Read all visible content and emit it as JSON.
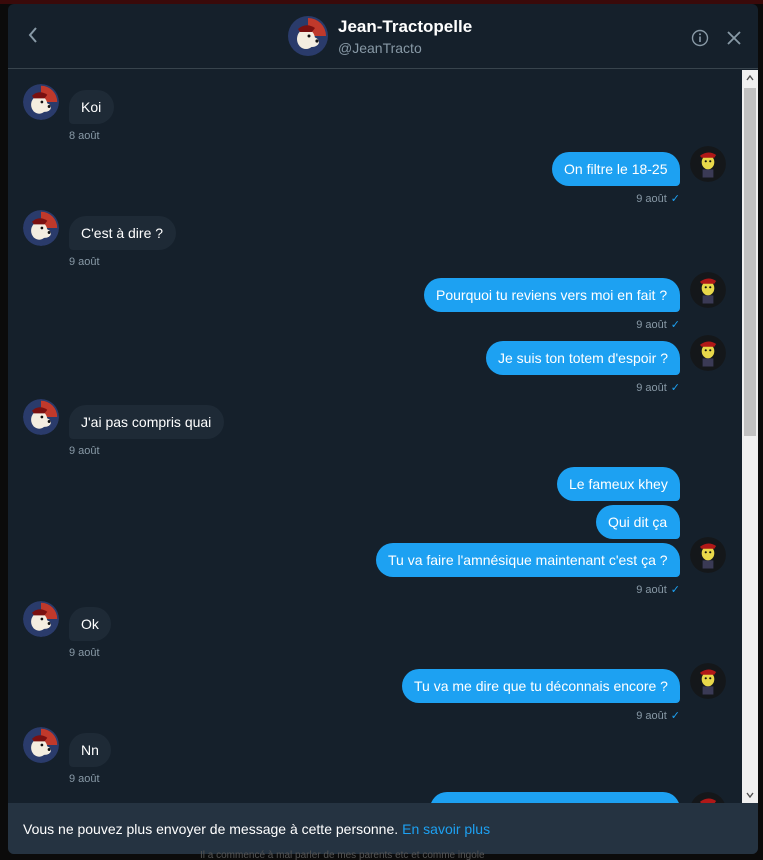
{
  "header": {
    "name": "Jean-Tractopelle",
    "handle": "@JeanTracto",
    "back_icon": "chevron-left-icon",
    "info_icon": "info-icon",
    "close_icon": "close-icon"
  },
  "messages": [
    {
      "dir": "in",
      "text": "Koi",
      "time": "8 août"
    },
    {
      "dir": "out",
      "text": "On filtre le 18-25",
      "time": "9 août"
    },
    {
      "dir": "in",
      "text": "C'est à dire ?",
      "time": "9 août"
    },
    {
      "dir": "out",
      "text": "Pourquoi tu reviens vers moi en fait ?",
      "time": "9 août"
    },
    {
      "dir": "out",
      "text": "Je suis ton totem d'espoir ?",
      "time": "9 août"
    },
    {
      "dir": "in",
      "text": "J'ai pas compris quai",
      "time": "9 août"
    },
    {
      "dir": "out",
      "text": "Le fameux khey",
      "time": ""
    },
    {
      "dir": "out",
      "text": "Qui dit ça",
      "time": ""
    },
    {
      "dir": "out",
      "text": "Tu va faire l'amnésique maintenant c'est ça ?",
      "time": "9 août"
    },
    {
      "dir": "in",
      "text": "Ok",
      "time": "9 août"
    },
    {
      "dir": "out",
      "text": "Tu va me dire que tu déconnais encore ?",
      "time": "9 août"
    },
    {
      "dir": "in",
      "text": "Nn",
      "time": "9 août"
    },
    {
      "dir": "out",
      "text": "",
      "time": ""
    }
  ],
  "footer": {
    "notice": "Vous ne pouvez plus envoyer de message à cette personne.",
    "link": "En savoir plus"
  },
  "background_text": "Il a commencé à mal parler de mes parents etc et comme ingole",
  "colors": {
    "background": "#15202b",
    "accent": "#1da1f2",
    "incoming_bubble": "#1e2a36",
    "muted_text": "#8899a6",
    "footer": "#253341"
  }
}
